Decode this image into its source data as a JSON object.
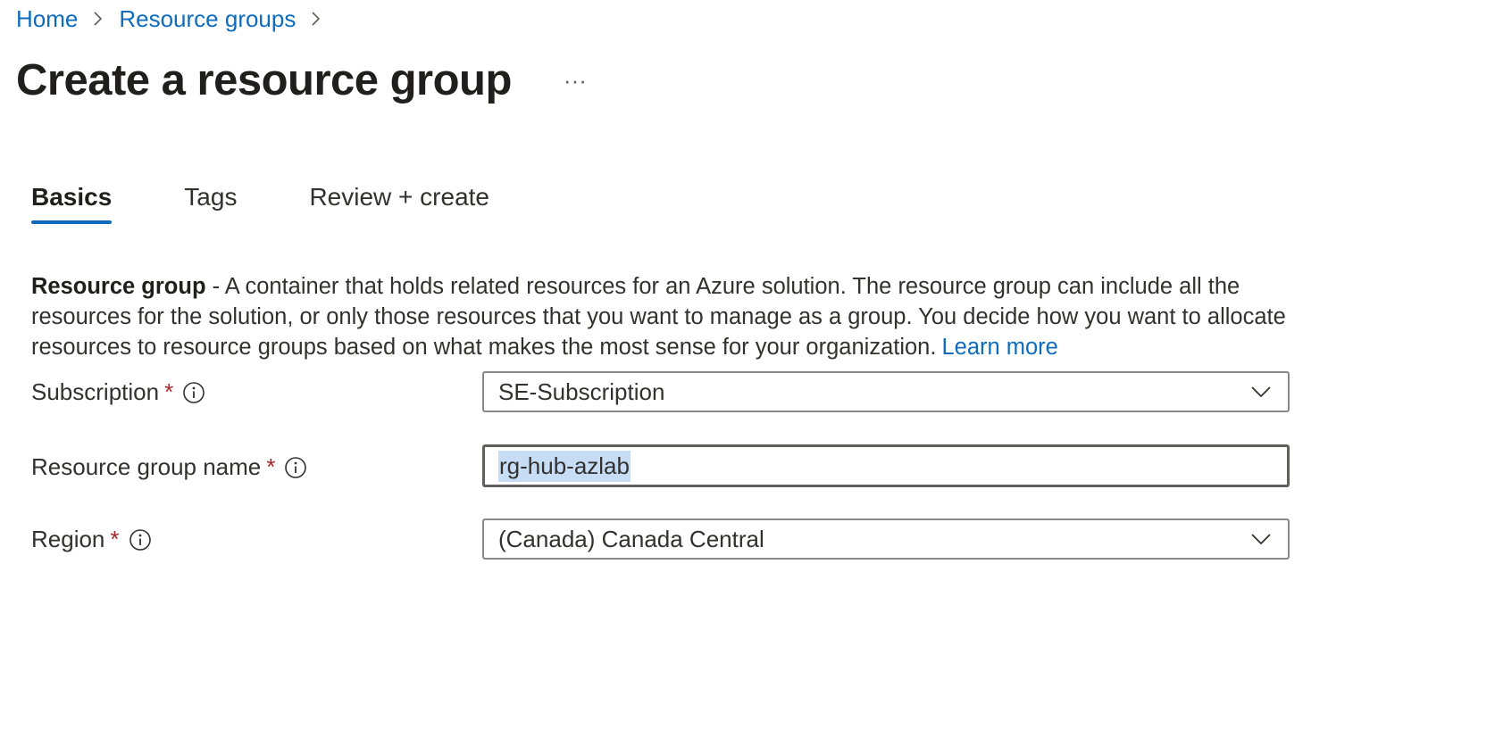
{
  "breadcrumb": {
    "items": [
      "Home",
      "Resource groups"
    ]
  },
  "page": {
    "title": "Create a resource group",
    "more_label": "···"
  },
  "tabs": [
    {
      "label": "Basics",
      "active": true
    },
    {
      "label": "Tags",
      "active": false
    },
    {
      "label": "Review + create",
      "active": false
    }
  ],
  "description": {
    "bold": "Resource group",
    "text": " - A container that holds related resources for an Azure solution. The resource group can include all the resources for the solution, or only those resources that you want to manage as a group. You decide how you want to allocate resources to resource groups based on what makes the most sense for your organization.",
    "link": "Learn more"
  },
  "form": {
    "subscription": {
      "label": "Subscription",
      "required": "*",
      "value": "SE-Subscription"
    },
    "resource_group_name": {
      "label": "Resource group name",
      "required": "*",
      "value": "rg-hub-azlab"
    },
    "region": {
      "label": "Region",
      "required": "*",
      "value": "(Canada) Canada Central"
    }
  },
  "colors": {
    "link": "#0f6cbd",
    "required": "#a4262c",
    "selection": "#c7dcf5"
  },
  "icons": {
    "breadcrumb_separator": "chevron-right-icon",
    "info": "info-icon",
    "dropdown": "chevron-down-icon"
  }
}
